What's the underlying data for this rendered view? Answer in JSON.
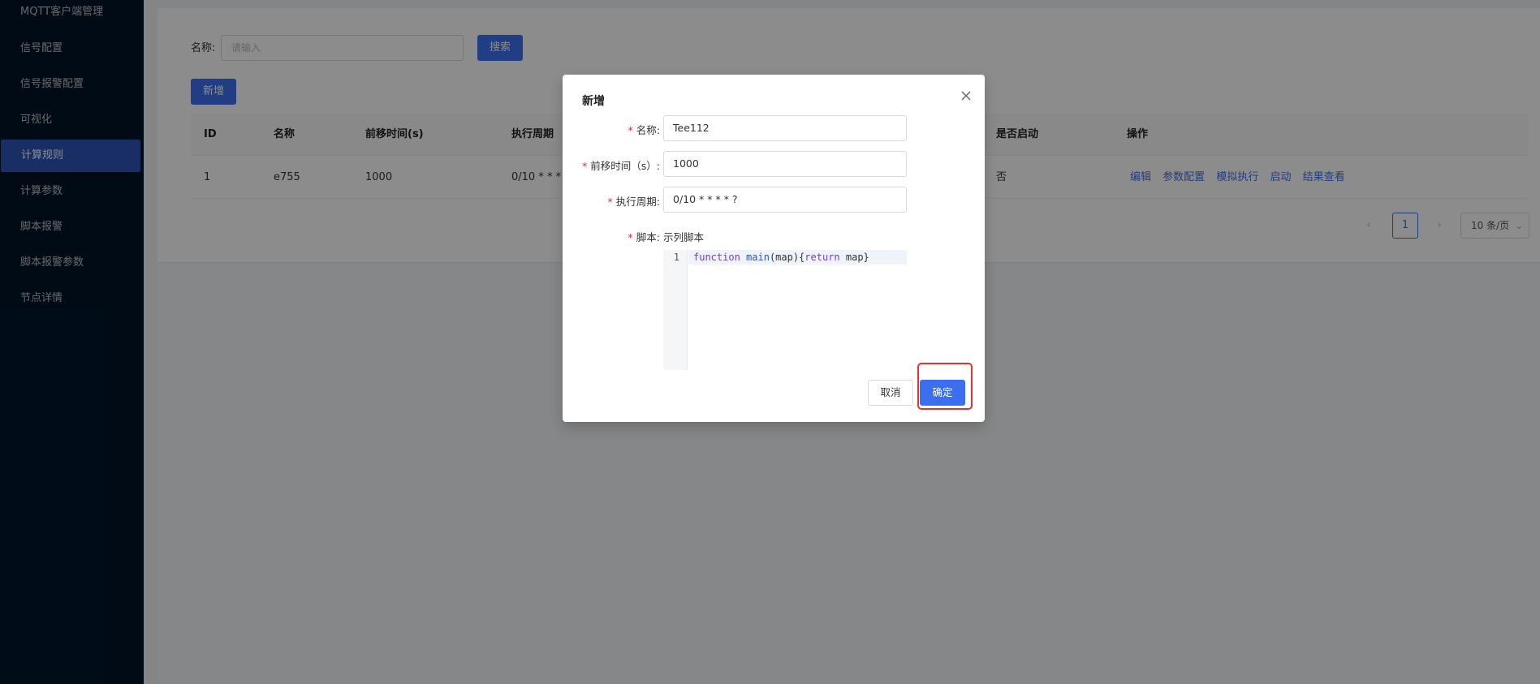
{
  "sidebar": {
    "items": [
      {
        "label": "MQTT客户端管理"
      },
      {
        "label": "信号配置"
      },
      {
        "label": "信号报警配置"
      },
      {
        "label": "可视化"
      },
      {
        "label": "计算规则"
      },
      {
        "label": "计算参数"
      },
      {
        "label": "脚本报警"
      },
      {
        "label": "脚本报警参数"
      },
      {
        "label": "节点详情"
      }
    ],
    "active_index": 4
  },
  "search": {
    "label": "名称:",
    "placeholder": "请输入",
    "button": "搜索"
  },
  "toolbar": {
    "add_button": "新增"
  },
  "table": {
    "columns": [
      "ID",
      "名称",
      "前移时间(s)",
      "执行周期",
      "是否启动",
      "操作"
    ],
    "rows": [
      {
        "id": "1",
        "name": "e755",
        "offset": "1000",
        "cycle": "0/10 * * * * ?",
        "enabled": "否"
      }
    ],
    "actions": [
      "编辑",
      "参数配置",
      "模拟执行",
      "启动",
      "结果查看"
    ]
  },
  "pagination": {
    "prev": "‹",
    "current": "1",
    "next": "›",
    "page_size": "10 条/页"
  },
  "modal": {
    "title": "新增",
    "fields": {
      "name_label": "名称:",
      "name_value": "Tee112",
      "offset_label": "前移时间（s）:",
      "offset_value": "1000",
      "cycle_label": "执行周期:",
      "cycle_value": "0/10 * * * * ?",
      "script_label": "脚本:",
      "script_example": "示列脚本"
    },
    "editor": {
      "line_number": "1",
      "code_kw1": "function",
      "code_fn": "main",
      "code_arg": "(map){",
      "code_kw2": "return",
      "code_rest": " map}"
    },
    "cancel": "取消",
    "ok": "确定",
    "required_mark": "*"
  },
  "colors": {
    "sidebar_bg": "#001529",
    "primary": "#3c6ff0",
    "highlight": "#e8312f"
  }
}
